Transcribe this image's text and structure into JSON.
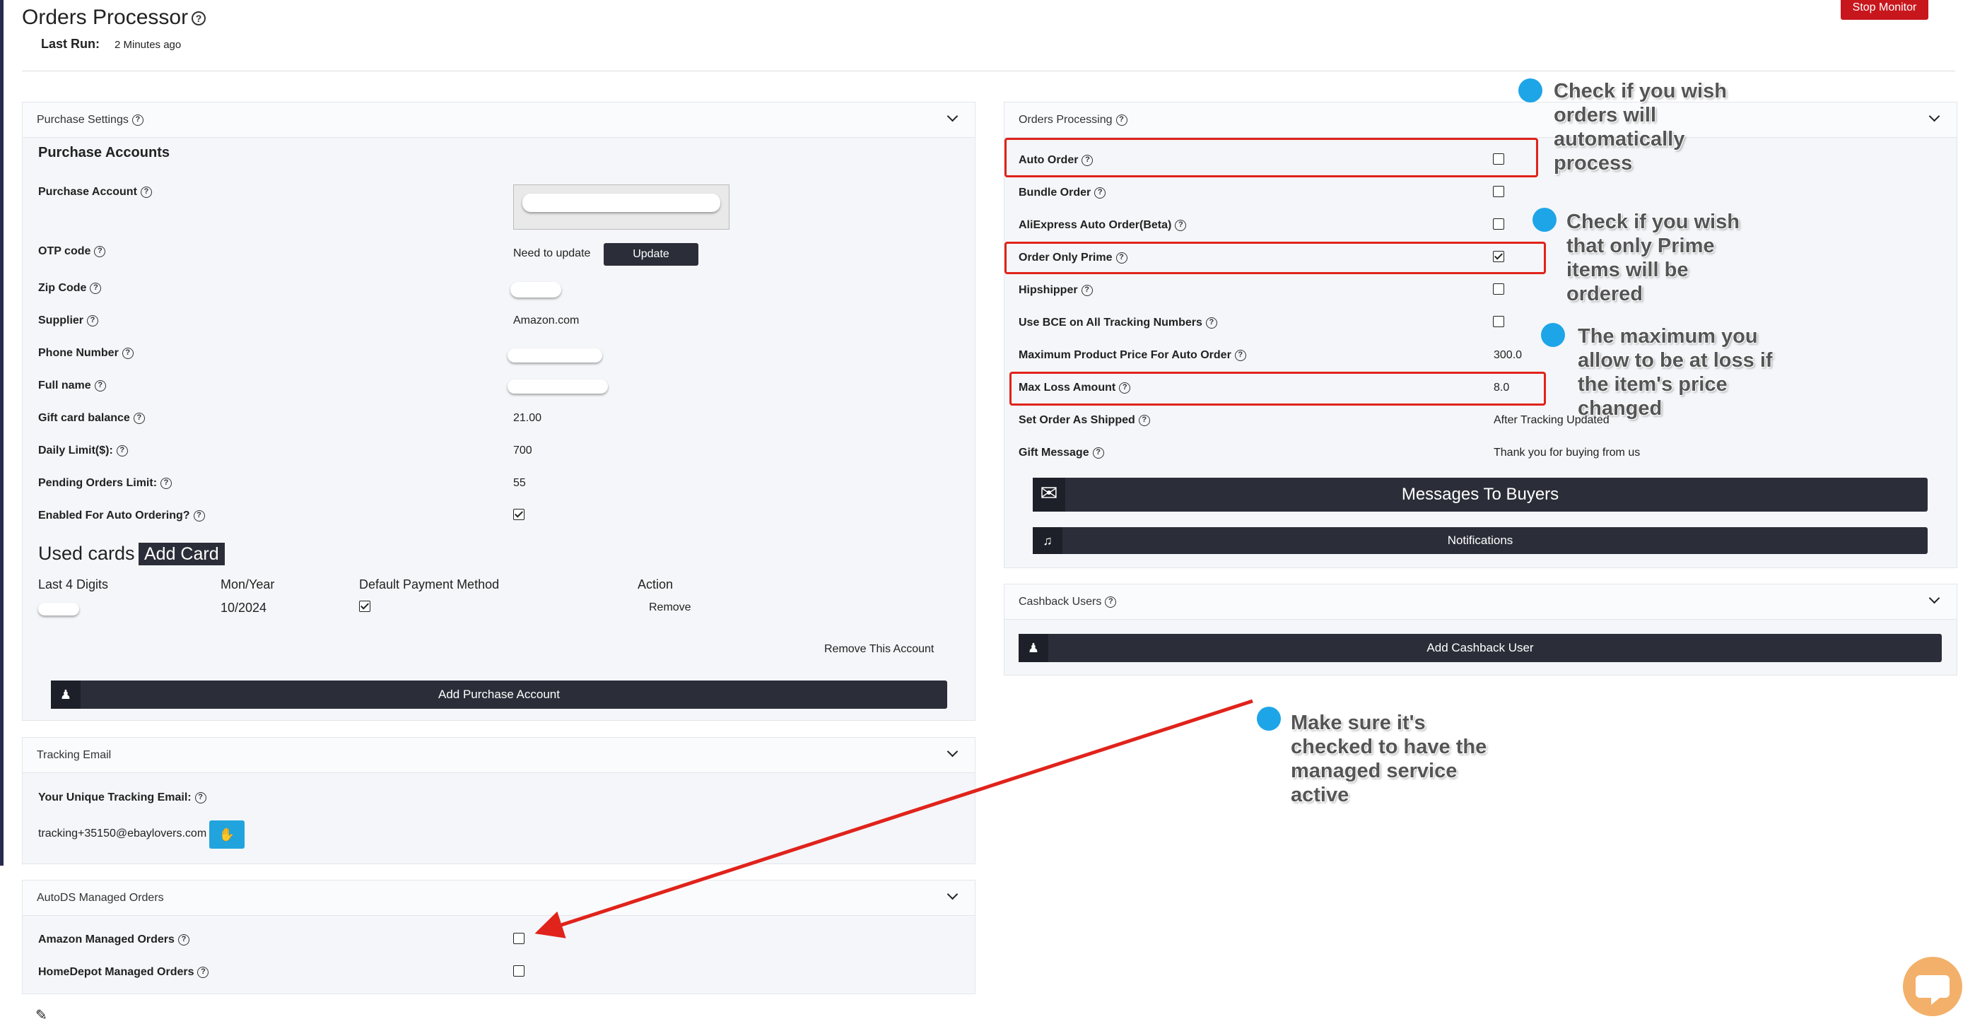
{
  "header": {
    "title": "Orders Processor",
    "last_run_label": "Last Run:",
    "last_run_value": "2 Minutes ago",
    "stop_button": "Stop Monitor"
  },
  "purchase_settings": {
    "title": "Purchase Settings",
    "section_title": "Purchase Accounts",
    "rows": {
      "purchase_account": "Purchase Account",
      "otp_label": "OTP code",
      "otp_value": "Need to update",
      "update_button": "Update",
      "zip_label": "Zip Code",
      "supplier_label": "Supplier",
      "supplier_value": "Amazon.com",
      "phone_label": "Phone Number",
      "fullname_label": "Full name",
      "giftcard_label": "Gift card balance",
      "giftcard_value": "21.00",
      "daily_label": "Daily Limit($):",
      "daily_value": "700",
      "pending_label": "Pending Orders Limit:",
      "pending_value": "55",
      "enabled_label": "Enabled For Auto Ordering?"
    },
    "used_cards_title": "Used cards",
    "add_card_button": "Add Card",
    "cards_columns": [
      "Last 4 Digits",
      "Mon/Year",
      "Default Payment Method",
      "Action"
    ],
    "card_row": {
      "mon_year": "10/2024",
      "action": "Remove"
    },
    "remove_account": "Remove This Account",
    "add_purchase_account": "Add Purchase Account"
  },
  "tracking_email": {
    "title": "Tracking Email",
    "label": "Your Unique Tracking Email:",
    "value": "tracking+35150@ebaylovers.com"
  },
  "managed_orders": {
    "title": "AutoDS Managed Orders",
    "amazon": "Amazon Managed Orders",
    "homedepot": "HomeDepot Managed Orders"
  },
  "orders_processing": {
    "title": "Orders Processing",
    "rows": {
      "auto_order": "Auto Order",
      "bundle_order": "Bundle Order",
      "aliexpress": "AliExpress Auto Order(Beta)",
      "prime": "Order Only Prime",
      "hipshipper": "Hipshipper",
      "bce": "Use BCE on All Tracking Numbers",
      "max_price_label": "Maximum Product Price For Auto Order",
      "max_price_value": "300.0",
      "max_loss_label": "Max Loss Amount",
      "max_loss_value": "8.0",
      "shipped_label": "Set Order As Shipped",
      "shipped_value": "After Tracking Updated",
      "gift_label": "Gift Message",
      "gift_value": "Thank you for buying from us"
    },
    "messages_button": "Messages To Buyers",
    "notifications_button": "Notifications"
  },
  "cashback": {
    "title": "Cashback Users",
    "add_button": "Add Cashback User"
  },
  "annotations": {
    "auto_order": [
      "Check if you wish",
      "orders will",
      "automatically",
      "process"
    ],
    "prime": [
      "Check if you wish",
      "that only Prime",
      "items will be",
      "ordered"
    ],
    "max_loss": [
      "The maximum you",
      "allow to be at loss if",
      "the item's price",
      "changed"
    ],
    "managed": [
      "Make sure it's",
      "checked to have the",
      "managed service",
      "active"
    ]
  },
  "colors": {
    "accent": "#c8161d",
    "dark_button": "#2b2e38",
    "annotation_red": "#e0231b",
    "bubble": "#1ea5e8",
    "copy_button": "#21a4dd"
  },
  "icons": [
    "help-icon",
    "chevron-down-icon",
    "envelope-icon",
    "bell-icon",
    "user-plus-icon",
    "copy-icon",
    "chat-icon",
    "pencil-icon"
  ]
}
